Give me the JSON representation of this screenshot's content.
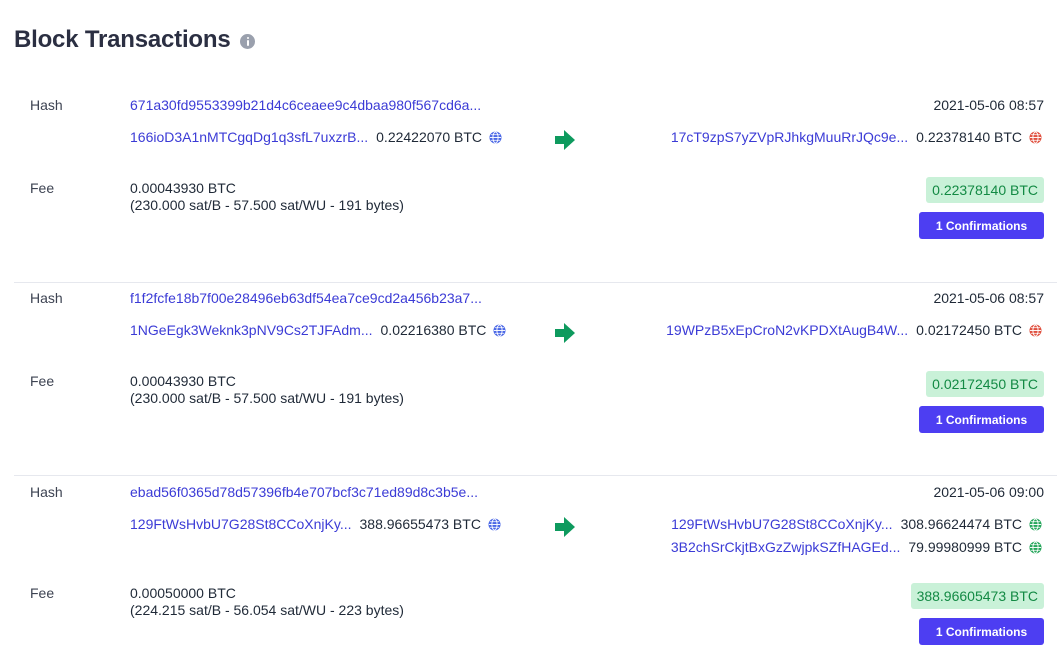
{
  "page": {
    "title": "Block Transactions"
  },
  "colors": {
    "link": "#3b3bd6",
    "arrow": "#0e9a5e",
    "badge_bg": "#c9f1d8",
    "badge_text": "#138a44",
    "button": "#4d3ef2",
    "globe_blue": "#4a67e6",
    "globe_red": "#e0503f",
    "globe_green": "#26a65b"
  },
  "labels": {
    "hash": "Hash",
    "fee": "Fee"
  },
  "transactions": [
    {
      "hash": "671a30fd9553399b21d4c6ceaee9c4dbaa980f567cd6a...",
      "date": "2021-05-06 08:57",
      "inputs": [
        {
          "address": "166ioD3A1nMTCgqDg1q3sfL7uxzrB...",
          "amount": "0.22422070 BTC",
          "icon": "globe-icon-blue"
        }
      ],
      "outputs": [
        {
          "address": "17cT9zpS7yZVpRJhkgMuuRrJQc9e...",
          "amount": "0.22378140 BTC",
          "icon": "globe-icon-red"
        }
      ],
      "fee": "0.00043930 BTC",
      "fee_detail": "(230.000 sat/B - 57.500 sat/WU - 191 bytes)",
      "total": "0.22378140 BTC",
      "confirmations": "1 Confirmations"
    },
    {
      "hash": "f1f2fcfe18b7f00e28496eb63df54ea7ce9cd2a456b23a7...",
      "date": "2021-05-06 08:57",
      "inputs": [
        {
          "address": "1NGeEgk3Weknk3pNV9Cs2TJFAdm...",
          "amount": "0.02216380 BTC",
          "icon": "globe-icon-blue"
        }
      ],
      "outputs": [
        {
          "address": "19WPzB5xEpCroN2vKPDXtAugB4W...",
          "amount": "0.02172450 BTC",
          "icon": "globe-icon-red"
        }
      ],
      "fee": "0.00043930 BTC",
      "fee_detail": "(230.000 sat/B - 57.500 sat/WU - 191 bytes)",
      "total": "0.02172450 BTC",
      "confirmations": "1 Confirmations"
    },
    {
      "hash": "ebad56f0365d78d57396fb4e707bcf3c71ed89d8c3b5e...",
      "date": "2021-05-06 09:00",
      "inputs": [
        {
          "address": "129FtWsHvbU7G28St8CCoXnjKy...",
          "amount": "388.96655473 BTC",
          "icon": "globe-icon-blue"
        }
      ],
      "outputs": [
        {
          "address": "129FtWsHvbU7G28St8CCoXnjKy...",
          "amount": "308.96624474 BTC",
          "icon": "globe-icon-green"
        },
        {
          "address": "3B2chSrCkjtBxGzZwjpkSZfHAGEd...",
          "amount": "79.99980999 BTC",
          "icon": "globe-icon-green"
        }
      ],
      "fee": "0.00050000 BTC",
      "fee_detail": "(224.215 sat/B - 56.054 sat/WU - 223 bytes)",
      "total": "388.96605473 BTC",
      "confirmations": "1 Confirmations"
    }
  ]
}
